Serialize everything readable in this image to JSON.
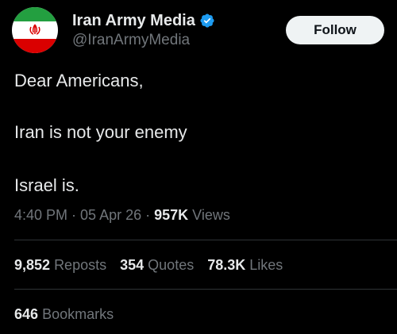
{
  "author": {
    "display_name": "Iran Army Media",
    "handle": "@IranArmyMedia",
    "verified_icon": "verified-badge-icon",
    "avatar_colors": {
      "top": "#239f40",
      "middle": "#ffffff",
      "bottom": "#da0000"
    }
  },
  "follow_label": "Follow",
  "tweet": {
    "line1": "Dear Americans,",
    "line2": "Iran is not your enemy",
    "line3": "Israel is."
  },
  "meta": {
    "time": "4:40 PM",
    "sep1": " · ",
    "date": "05 Apr 26",
    "sep2": " · ",
    "views_count": "957K",
    "views_label": " Views"
  },
  "stats": {
    "reposts_count": "9,852",
    "reposts_label": "Reposts",
    "quotes_count": "354",
    "quotes_label": "Quotes",
    "likes_count": "78.3K",
    "likes_label": "Likes",
    "bookmarks_count": "646",
    "bookmarks_label": "Bookmarks"
  },
  "colors": {
    "background": "#000000",
    "text": "#e7e9ea",
    "muted": "#71767b",
    "verified": "#1d9bf0"
  }
}
